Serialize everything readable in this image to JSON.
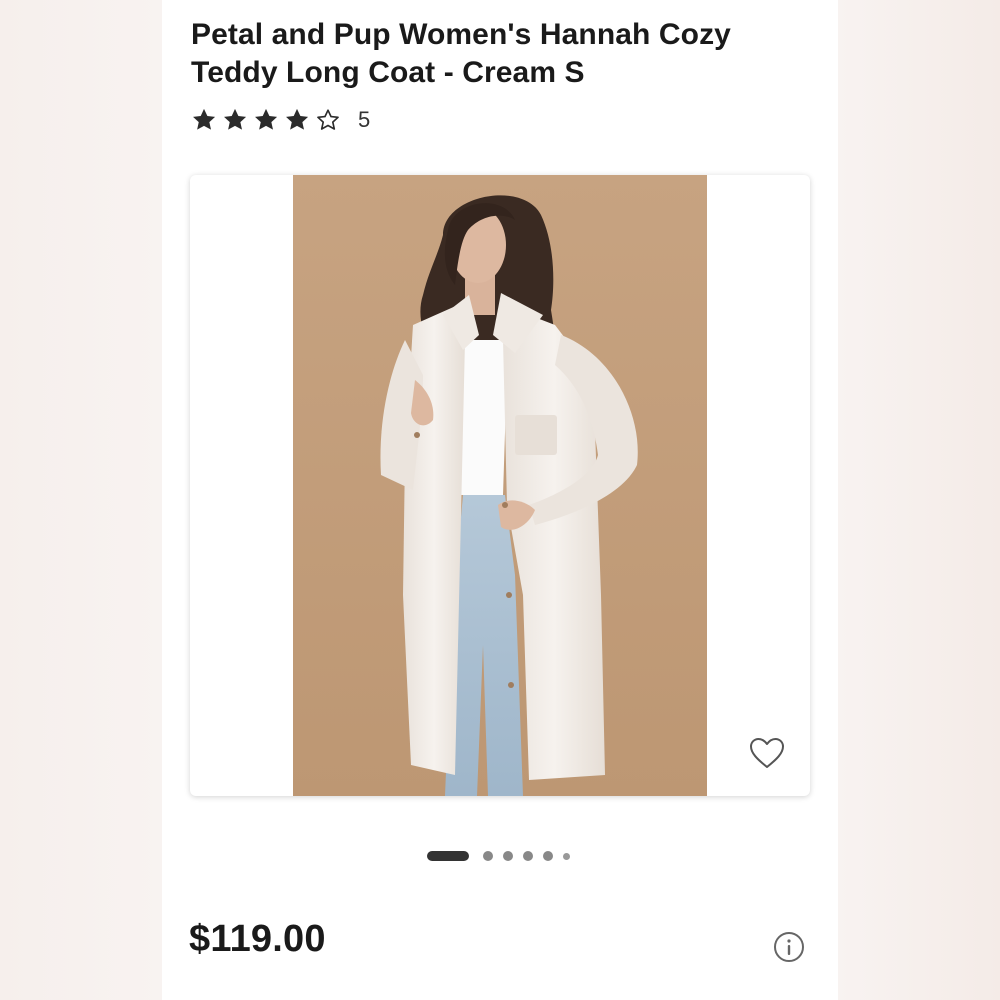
{
  "product": {
    "title": "Petal and Pup Women's Hannah Cozy Teddy Long Coat - Cream S",
    "rating": 4,
    "rating_max": 5,
    "review_count": "5",
    "price": "$119.00"
  },
  "gallery": {
    "image_count": 6,
    "active_index": 0
  },
  "icons": {
    "star_filled": "star-filled-icon",
    "star_empty": "star-outline-icon",
    "favorite": "heart-outline-icon",
    "info": "info-circle-icon"
  },
  "colors": {
    "text": "#1a1a1a",
    "photo_background": "#c4a17f",
    "coat": "#f4efea",
    "active_dot": "#333333"
  }
}
